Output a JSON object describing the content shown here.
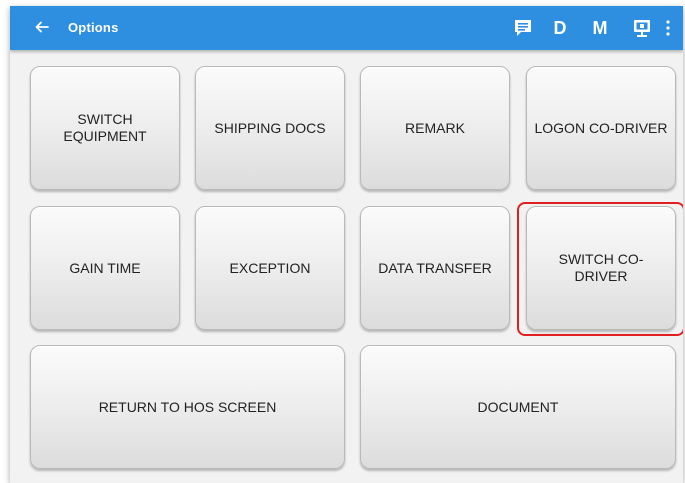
{
  "appbar": {
    "title": "Options",
    "actions": [
      {
        "label": "",
        "icon": "message-icon"
      },
      {
        "label": "D",
        "icon": "d-status"
      },
      {
        "label": "M",
        "icon": "m-status"
      },
      {
        "label": "",
        "icon": "device-icon"
      },
      {
        "label": "",
        "icon": "more-vert-icon"
      }
    ],
    "color": "#2e8ee0"
  },
  "buttons": {
    "switch_equipment": "SWITCH EQUIPMENT",
    "shipping_docs": "SHIPPING DOCS",
    "remark": "REMARK",
    "logon_co_driver": "LOGON CO-DRIVER",
    "gain_time": "GAIN TIME",
    "exception": "EXCEPTION",
    "data_transfer": "DATA TRANSFER",
    "switch_co_driver": "SWITCH CO-DRIVER",
    "return_to_hos": "RETURN TO HOS SCREEN",
    "document": "DOCUMENT"
  },
  "highlight_color": "#e02020"
}
